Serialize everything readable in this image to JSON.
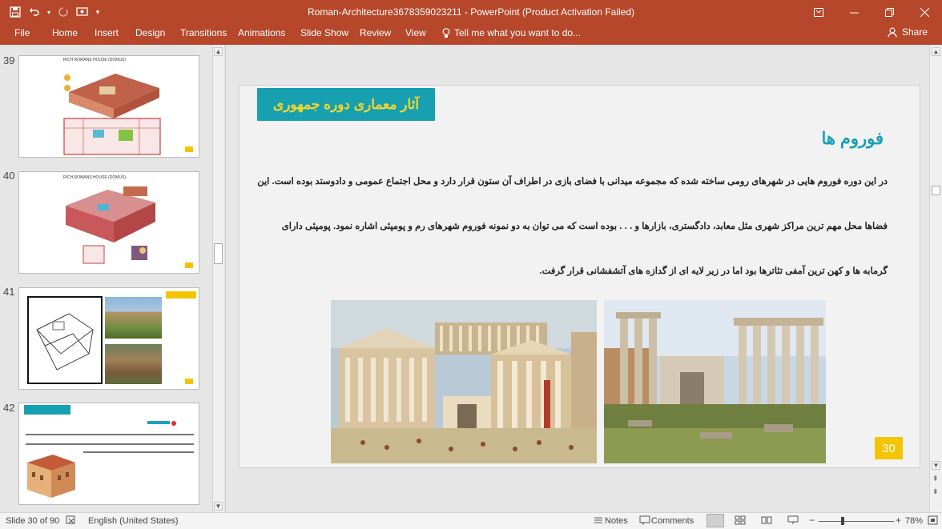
{
  "titlebar": {
    "title": "Roman-Architecture3678359023211  -  PowerPoint (Product Activation Failed)",
    "qat": {
      "save_icon": "save-icon",
      "undo_icon": "undo-icon",
      "redo_icon": "redo-icon",
      "present_icon": "present-from-beginning-icon",
      "customize_icon": "customize-qat-icon"
    },
    "controls": {
      "ribbon_display_icon": "ribbon-display-icon",
      "minimize_icon": "minimize-icon",
      "restore_icon": "restore-icon",
      "close_icon": "close-icon"
    }
  },
  "ribbon": {
    "tabs": [
      "File",
      "Home",
      "Insert",
      "Design",
      "Transitions",
      "Animations",
      "Slide Show",
      "Review",
      "View"
    ],
    "tell_me": "Tell me what you want to do...",
    "share": "Share"
  },
  "thumbnails": [
    {
      "number": "39",
      "heading": "RICH ROMANS HOUSE (DOMUS)"
    },
    {
      "number": "40",
      "heading": "RICH ROMANS HOUSE (DOMUS)"
    },
    {
      "number": "41",
      "heading": ""
    },
    {
      "number": "42",
      "heading": ""
    }
  ],
  "slide": {
    "title": "آثار معماری دوره جمهوری",
    "subtitle": "فوروم ها",
    "paragraph_lines": [
      "در این دوره فوروم هایی در شهرهای رومی ساخته شده که مجموعه میدانی با فضای بازی در اطراف آن ستون قرار دارد و محل اجتماع عمومی و دادوستد بوده است. این",
      "فضاها محل مهم ترین مراکز شهری مثل معابد، دادگستری، بازارها و . . . بوده است که می توان به دو نمونه فوروم شهرهای رم و پومپئی اشاره نمود. پومپئی دارای",
      "گرمابه ها و کهن ترین آمفی تئاترها بود اما در زیر لایه ای از گدازه های آتشفشانی قرار گرفت."
    ],
    "number": "30"
  },
  "statusbar": {
    "slide_info": "Slide 30 of 90",
    "language": "English (United States)",
    "notes": "Notes",
    "comments": "Comments",
    "zoom": "78%"
  },
  "colors": {
    "accent": "#b7472a",
    "slide_title_bg": "#16a0b0",
    "slide_title_text": "#f7d52c",
    "subtitle": "#1aa0b8",
    "number_badge": "#f5c400"
  }
}
